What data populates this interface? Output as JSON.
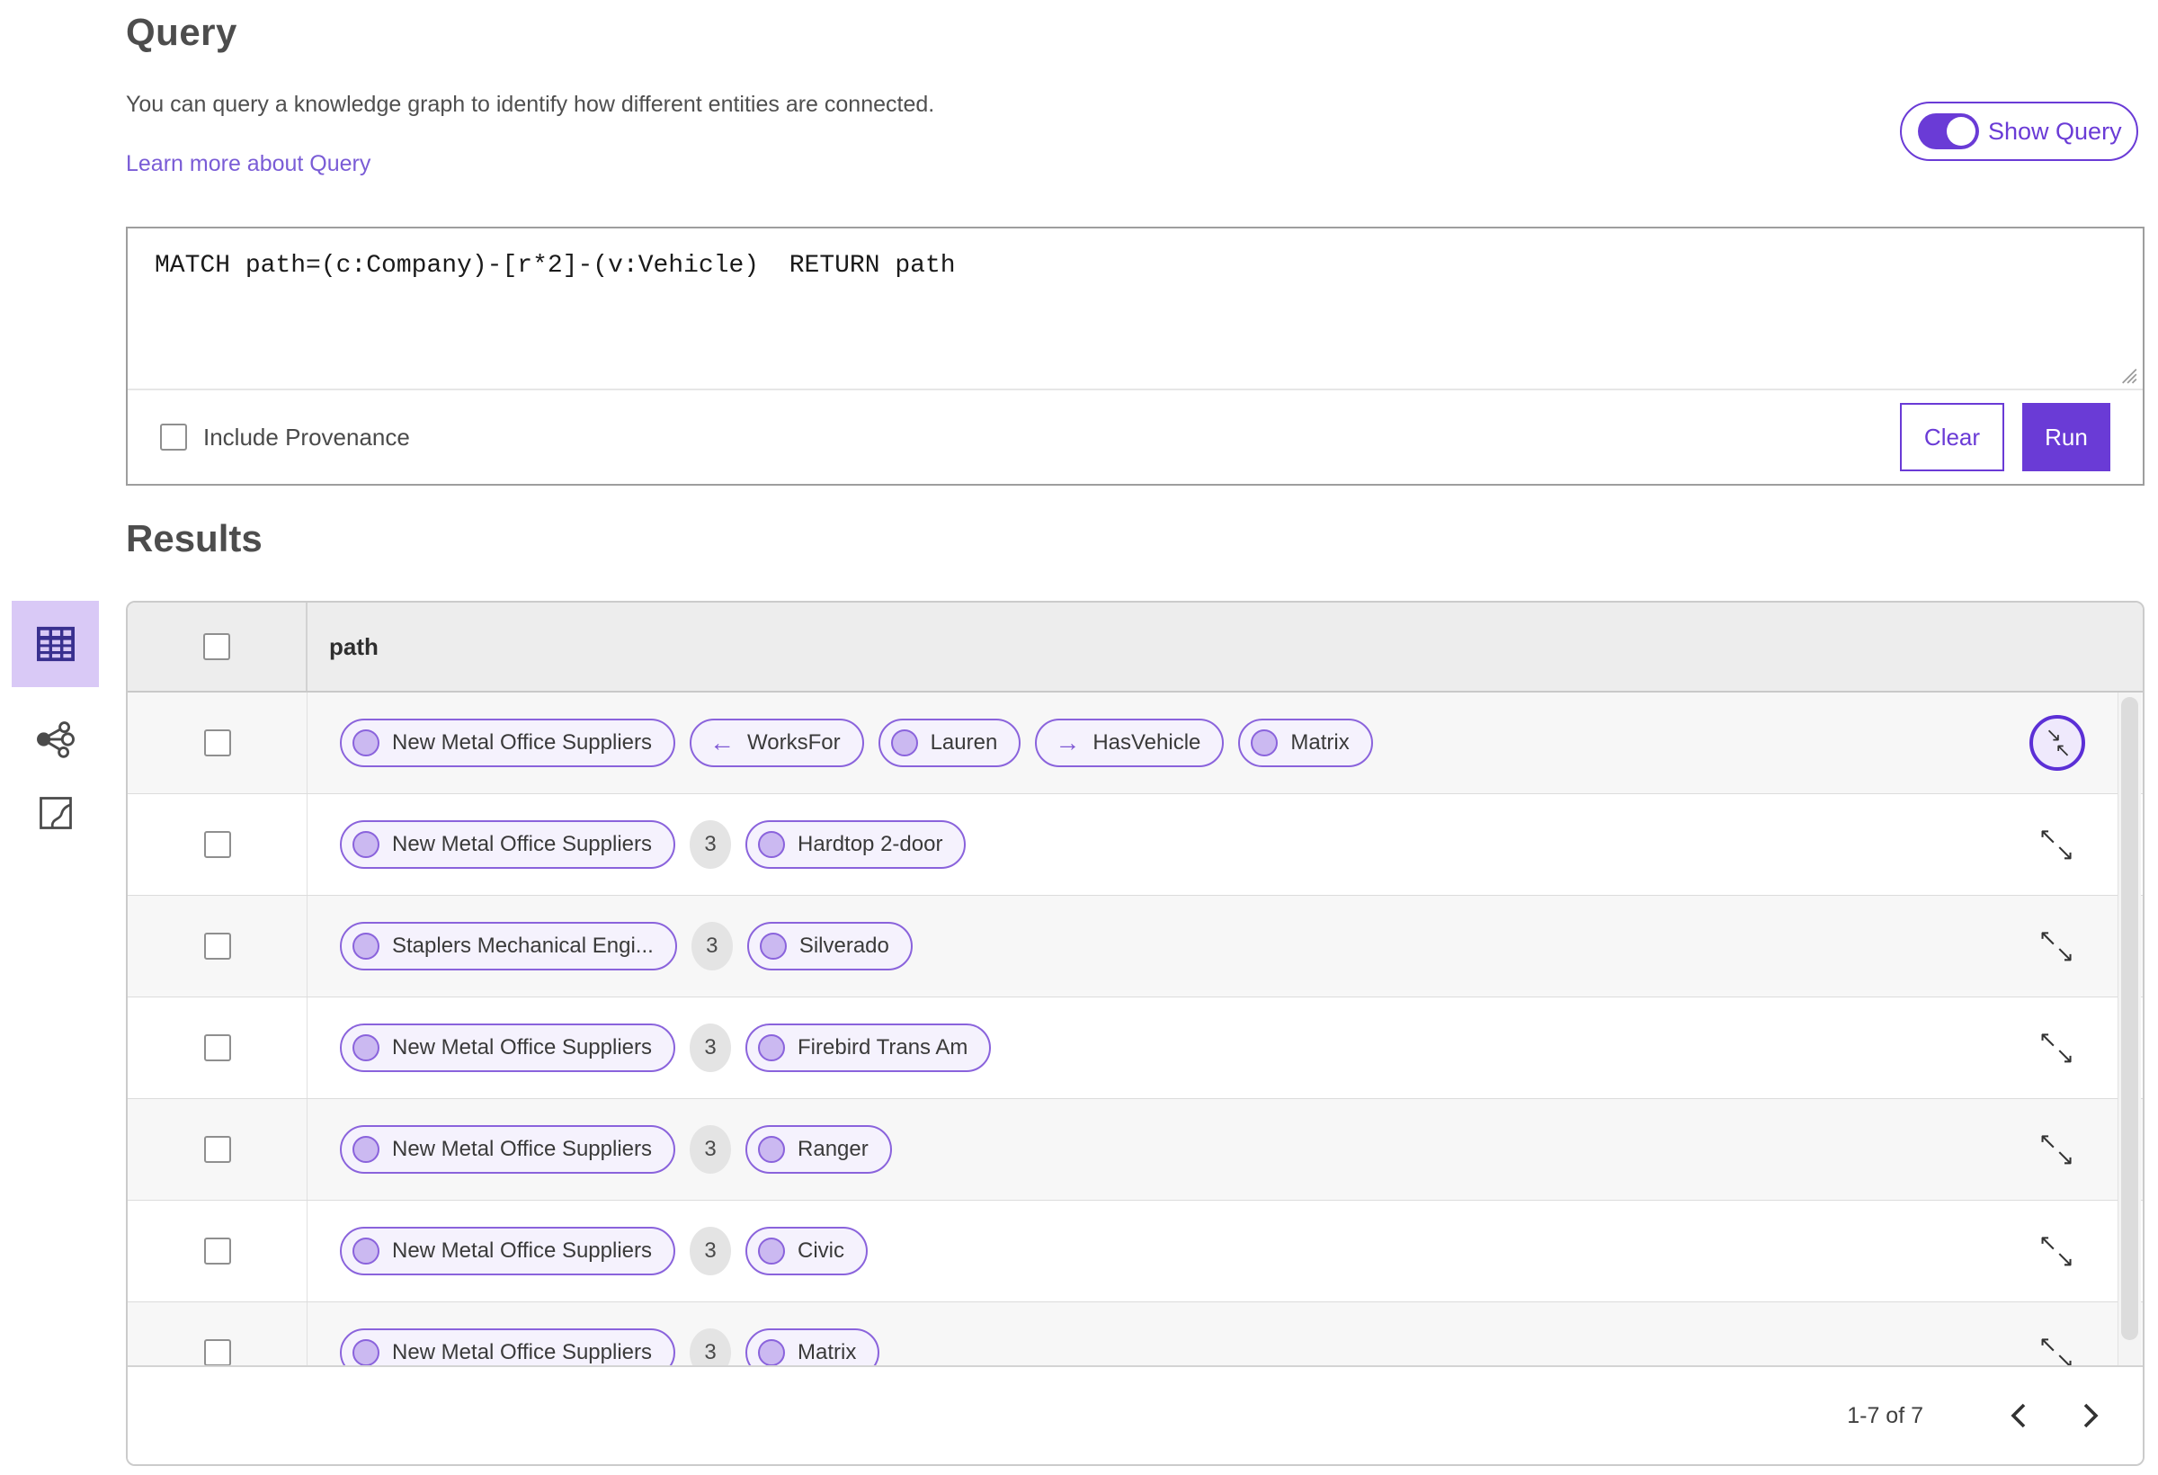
{
  "header": {
    "title": "Query",
    "description": "You can query a knowledge graph to identify how different entities are connected.",
    "learn_more": "Learn more about Query",
    "show_query_label": "Show Query",
    "show_query_on": true
  },
  "query_panel": {
    "query_text": "MATCH path=(c:Company)-[r*2]-(v:Vehicle)  RETURN path",
    "include_provenance_label": "Include Provenance",
    "include_provenance_checked": false,
    "clear_label": "Clear",
    "run_label": "Run"
  },
  "results": {
    "title": "Results",
    "column_header": "path",
    "views": [
      {
        "name": "table-view",
        "selected": true
      },
      {
        "name": "graph-view",
        "selected": false
      },
      {
        "name": "map-view",
        "selected": false
      }
    ],
    "rows": [
      {
        "zebra": true,
        "expand": "circled",
        "cells": [
          {
            "kind": "entity",
            "label": "New Metal Office Suppliers"
          },
          {
            "kind": "relation",
            "arrow": "left",
            "label": "WorksFor"
          },
          {
            "kind": "entity",
            "label": "Lauren"
          },
          {
            "kind": "relation",
            "arrow": "right",
            "label": "HasVehicle"
          },
          {
            "kind": "entity",
            "label": "Matrix"
          }
        ]
      },
      {
        "zebra": false,
        "expand": "plain",
        "cells": [
          {
            "kind": "entity",
            "label": "New Metal Office Suppliers"
          },
          {
            "kind": "count",
            "label": "3"
          },
          {
            "kind": "entity",
            "label": "Hardtop 2-door"
          }
        ]
      },
      {
        "zebra": true,
        "expand": "plain",
        "cells": [
          {
            "kind": "entity",
            "label": "Staplers Mechanical Engi..."
          },
          {
            "kind": "count",
            "label": "3"
          },
          {
            "kind": "entity",
            "label": "Silverado"
          }
        ]
      },
      {
        "zebra": false,
        "expand": "plain",
        "cells": [
          {
            "kind": "entity",
            "label": "New Metal Office Suppliers"
          },
          {
            "kind": "count",
            "label": "3"
          },
          {
            "kind": "entity",
            "label": "Firebird Trans Am"
          }
        ]
      },
      {
        "zebra": true,
        "expand": "plain",
        "cells": [
          {
            "kind": "entity",
            "label": "New Metal Office Suppliers"
          },
          {
            "kind": "count",
            "label": "3"
          },
          {
            "kind": "entity",
            "label": "Ranger"
          }
        ]
      },
      {
        "zebra": false,
        "expand": "plain",
        "cells": [
          {
            "kind": "entity",
            "label": "New Metal Office Suppliers"
          },
          {
            "kind": "count",
            "label": "3"
          },
          {
            "kind": "entity",
            "label": "Civic"
          }
        ]
      },
      {
        "zebra": true,
        "expand": "plain",
        "cells": [
          {
            "kind": "entity",
            "label": "New Metal Office Suppliers"
          },
          {
            "kind": "count",
            "label": "3"
          },
          {
            "kind": "entity",
            "label": "Matrix"
          }
        ]
      }
    ],
    "pagination": {
      "label": "1-7 of 7"
    }
  },
  "icons": {
    "table-view-icon": "table grid",
    "graph-view-icon": "link-chart nodes",
    "map-view-icon": "map with path",
    "collapse-icon": "↘↖ inward arrows in circle",
    "expand-icon": "↖↘ outward arrows",
    "left-arrow": "←",
    "right-arrow": "→",
    "chevron-left-icon": "‹",
    "chevron-right-icon": "›",
    "resize-handle-icon": "diagonal grip lines"
  },
  "colors": {
    "accent": "#6a3bd6",
    "pill_border": "#8a63dc",
    "pill_bg": "#f5f2fd",
    "node_fill": "#cbb9f1",
    "link": "#7a5cd6",
    "selected_view_bg": "#d9c9f6",
    "header_row_bg": "#ededed",
    "zebra_row_bg": "#f7f7f7"
  }
}
